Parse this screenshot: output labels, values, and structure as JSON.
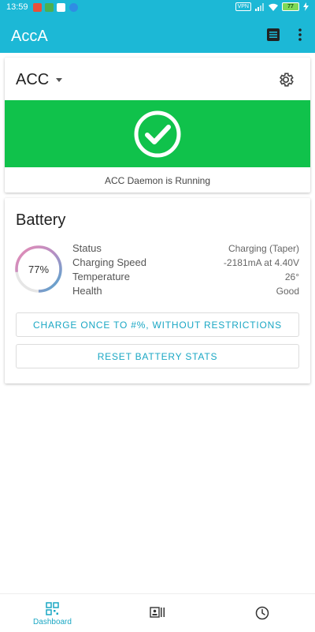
{
  "status_bar": {
    "time": "13:59",
    "vpn": "VPN",
    "battery_level": "77"
  },
  "toolbar": {
    "title": "AccA",
    "icons": [
      "list-icon",
      "more-vert-icon"
    ]
  },
  "acc_card": {
    "title": "ACC",
    "status_text": "ACC Daemon is Running",
    "colors": {
      "banner": "#10c24b"
    }
  },
  "battery_card": {
    "title": "Battery",
    "percent_label": "77%",
    "level": 0.77,
    "stats": [
      {
        "label": "Status",
        "value": "Charging (Taper)"
      },
      {
        "label": "Charging Speed",
        "value": "-2181mA at 4.40V"
      },
      {
        "label": "Temperature",
        "value": "26°"
      },
      {
        "label": "Health",
        "value": "Good"
      }
    ],
    "buttons": {
      "charge_once": "CHARGE ONCE TO #%, WITHOUT RESTRICTIONS",
      "reset_stats": "RESET BATTERY STATS"
    }
  },
  "bottom_nav": {
    "items": [
      {
        "label": "Dashboard",
        "icon": "dashboard-icon",
        "active": true
      },
      {
        "label": "",
        "icon": "profiles-icon",
        "active": false
      },
      {
        "label": "",
        "icon": "schedule-icon",
        "active": false
      }
    ]
  },
  "colors": {
    "accent": "#1cb8d6",
    "accent_text": "#1aa7c4"
  }
}
